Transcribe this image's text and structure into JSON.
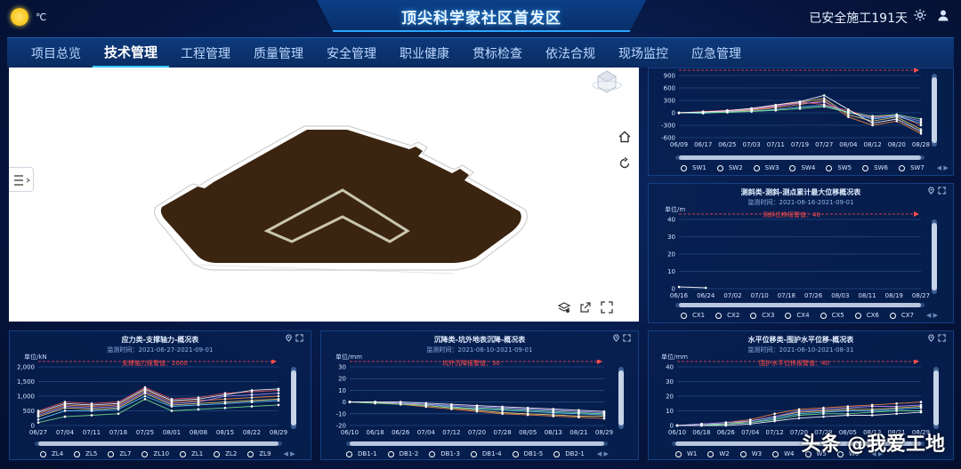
{
  "header": {
    "weather_icon": "sun-icon",
    "temperature_unit": "℃",
    "title": "顶尖科学家社区首发区",
    "safe_days": "已安全施工191天",
    "settings_icon": "gear-icon",
    "user_icon": "user-icon"
  },
  "nav": {
    "items": [
      "项目总览",
      "技术管理",
      "工程管理",
      "质量管理",
      "安全管理",
      "职业健康",
      "贯标检查",
      "依法合规",
      "现场监控",
      "应急管理"
    ],
    "active_index": 1
  },
  "viewport": {
    "tools": [
      "home-icon",
      "refresh-icon",
      "layers-icon",
      "export-icon",
      "fullscreen-icon"
    ]
  },
  "colors": {
    "accent": "#35c3ff",
    "panel_bg": "#072050",
    "warning": "#ff4b4b",
    "pit_fill": "#3b2410"
  },
  "panels": {
    "sw": {
      "title": "",
      "subtitle": "",
      "unit": "",
      "warning": "",
      "legend": [
        "SW1",
        "SW2",
        "SW3",
        "SW4",
        "SW5",
        "SW6",
        "SW7"
      ]
    },
    "cx": {
      "title": "测斜类-测斜-测点累计最大位移概况表",
      "subtitle": "监测时间：2021-06-16-2021-09-01",
      "unit": "单位/m",
      "warning": "测斜位移报警值：40",
      "legend": [
        "CX1",
        "CX2",
        "CX3",
        "CX4",
        "CX5",
        "CX6",
        "CX7"
      ]
    },
    "zl": {
      "title": "应力类-支撑轴力-概况表",
      "subtitle": "监测时间：2021-06-27-2021-09-01",
      "unit": "单位/kN",
      "warning": "支撑轴力报警值：2000",
      "legend": [
        "ZL4",
        "ZL5",
        "ZL7",
        "ZL10",
        "ZL1",
        "ZL2",
        "ZL9"
      ]
    },
    "db": {
      "title": "沉降类-坑外地表沉降-概况表",
      "subtitle": "监测时间：2021-06-10-2021-09-01",
      "unit": "单位/mm",
      "warning": "坑外沉降报警值：30",
      "legend": [
        "DB1-1",
        "DB1-2",
        "DB1-3",
        "DB1-4",
        "DB1-5",
        "DB2-1"
      ]
    },
    "w": {
      "title": "水平位移类-围护水平位移-概况表",
      "subtitle": "监测时间：2021-06-10-2021-08-31",
      "unit": "单位/mm",
      "warning": "围护水平位移报警值：40",
      "legend": [
        "W1",
        "W2",
        "W3",
        "W4",
        "W5",
        "W6"
      ]
    }
  },
  "chart_data": [
    {
      "id": "sw",
      "type": "line",
      "title": "",
      "x": [
        "06/09",
        "06/17",
        "06/25",
        "07/03",
        "07/11",
        "07/19",
        "07/27",
        "08/04",
        "08/12",
        "08/20",
        "08/28"
      ],
      "yticks": [
        900,
        600,
        300,
        0,
        -300,
        -600
      ],
      "ylim": [
        -600,
        900
      ],
      "warning_value": 900,
      "series": [
        {
          "name": "SW1",
          "color": "#ff8a3d",
          "values": [
            0,
            20,
            30,
            60,
            120,
            200,
            300,
            -100,
            -300,
            -200,
            -500
          ]
        },
        {
          "name": "SW2",
          "color": "#ffd166",
          "values": [
            0,
            10,
            20,
            80,
            150,
            250,
            350,
            -50,
            -200,
            -100,
            -400
          ]
        },
        {
          "name": "SW3",
          "color": "#ff5a5a",
          "values": [
            0,
            30,
            60,
            100,
            180,
            260,
            200,
            50,
            -100,
            -50,
            -300
          ]
        },
        {
          "name": "SW4",
          "color": "#6ad3ff",
          "values": [
            0,
            -10,
            20,
            40,
            80,
            140,
            180,
            20,
            -150,
            -80,
            -250
          ]
        },
        {
          "name": "SW5",
          "color": "#b48cff",
          "values": [
            0,
            15,
            40,
            90,
            160,
            230,
            260,
            0,
            -120,
            -60,
            -200
          ]
        },
        {
          "name": "SW6",
          "color": "#7be38a",
          "values": [
            0,
            5,
            10,
            30,
            60,
            100,
            150,
            10,
            -80,
            -40,
            -150
          ]
        },
        {
          "name": "SW7",
          "color": "#ffffff",
          "values": [
            0,
            20,
            50,
            110,
            190,
            270,
            420,
            80,
            -250,
            -150,
            -450
          ]
        }
      ]
    },
    {
      "id": "cx",
      "type": "line",
      "title": "测斜类-测斜-测点累计最大位移概况表",
      "x": [
        "06/16",
        "06/24",
        "07/02",
        "07/10",
        "07/18",
        "07/26",
        "08/03",
        "08/11",
        "08/19",
        "08/27"
      ],
      "yticks": [
        40,
        30,
        20,
        10,
        0
      ],
      "ylim": [
        0,
        40
      ],
      "warning_value": 40,
      "series": [
        {
          "name": "CX1",
          "color": "#ffffff",
          "values": [
            1,
            0.5,
            null,
            null,
            null,
            null,
            null,
            null,
            null,
            null
          ]
        }
      ]
    },
    {
      "id": "zl",
      "type": "line",
      "title": "应力类-支撑轴力-概况表",
      "x": [
        "06/27",
        "07/04",
        "07/11",
        "07/18",
        "07/25",
        "08/01",
        "08/08",
        "08/15",
        "08/22",
        "08/29"
      ],
      "yticks": [
        2000,
        1500,
        1000,
        500,
        0
      ],
      "ylim": [
        0,
        2000
      ],
      "warning_value": 2000,
      "series": [
        {
          "name": "ZL4",
          "color": "#ff8a3d",
          "values": [
            400,
            700,
            650,
            700,
            1200,
            800,
            850,
            900,
            950,
            1000
          ]
        },
        {
          "name": "ZL5",
          "color": "#ffd166",
          "values": [
            300,
            600,
            550,
            600,
            1100,
            700,
            750,
            800,
            850,
            900
          ]
        },
        {
          "name": "ZL7",
          "color": "#6ad3ff",
          "values": [
            200,
            500,
            500,
            550,
            1000,
            650,
            700,
            750,
            800,
            850
          ]
        },
        {
          "name": "ZL10",
          "color": "#ff5a5a",
          "values": [
            500,
            800,
            750,
            800,
            1300,
            900,
            950,
            1100,
            1150,
            1200
          ]
        },
        {
          "name": "ZL1",
          "color": "#7be38a",
          "values": [
            100,
            300,
            350,
            400,
            900,
            500,
            550,
            600,
            650,
            700
          ]
        },
        {
          "name": "ZL2",
          "color": "#b48cff",
          "values": [
            350,
            650,
            600,
            650,
            1150,
            750,
            800,
            1000,
            1050,
            1100
          ]
        },
        {
          "name": "ZL9",
          "color": "#ffffff",
          "values": [
            450,
            750,
            700,
            750,
            1250,
            850,
            900,
            1050,
            1200,
            1250
          ]
        }
      ]
    },
    {
      "id": "db",
      "type": "line",
      "title": "沉降类-坑外地表沉降-概况表",
      "x": [
        "06/10",
        "06/18",
        "06/26",
        "07/04",
        "07/12",
        "07/20",
        "07/28",
        "08/05",
        "08/13",
        "08/21",
        "08/29"
      ],
      "yticks": [
        30,
        20,
        10,
        0,
        -10,
        -20
      ],
      "ylim": [
        -20,
        30
      ],
      "warning_value": 30,
      "series": [
        {
          "name": "DB1-1",
          "color": "#ff8a3d",
          "values": [
            0,
            0,
            -2,
            -4,
            -6,
            -8,
            -10,
            -11,
            -12,
            -13,
            -14
          ]
        },
        {
          "name": "DB1-2",
          "color": "#ffd166",
          "values": [
            0,
            -1,
            -1,
            -3,
            -5,
            -7,
            -9,
            -10,
            -11,
            -12,
            -12
          ]
        },
        {
          "name": "DB1-3",
          "color": "#6ad3ff",
          "values": [
            0,
            0,
            -1,
            -2,
            -4,
            -6,
            -7,
            -8,
            -9,
            -10,
            -11
          ]
        },
        {
          "name": "DB1-4",
          "color": "#7be38a",
          "values": [
            0,
            -1,
            -2,
            -3,
            -5,
            -5,
            -6,
            -7,
            -8,
            -9,
            -10
          ]
        },
        {
          "name": "DB1-5",
          "color": "#b48cff",
          "values": [
            0,
            0,
            -1,
            -2,
            -3,
            -4,
            -5,
            -6,
            -7,
            -8,
            -9
          ]
        },
        {
          "name": "DB2-1",
          "color": "#ffffff",
          "values": [
            0,
            0,
            0,
            -1,
            -2,
            -3,
            -4,
            -5,
            -6,
            -7,
            -8
          ]
        }
      ]
    },
    {
      "id": "w",
      "type": "line",
      "title": "水平位移类-围护水平位移-概况表",
      "x": [
        "06/10",
        "06/18",
        "06/26",
        "07/04",
        "07/12",
        "07/20",
        "07/28",
        "08/05",
        "08/13",
        "08/21",
        "08/29"
      ],
      "yticks": [
        40,
        30,
        20,
        10,
        0
      ],
      "ylim": [
        0,
        40
      ],
      "warning_value": 40,
      "series": [
        {
          "name": "W1",
          "color": "#ff8a3d",
          "values": [
            0,
            1,
            2,
            4,
            8,
            11,
            12,
            13,
            14,
            15,
            16
          ]
        },
        {
          "name": "W2",
          "color": "#ffd166",
          "values": [
            0,
            0,
            1,
            3,
            6,
            9,
            10,
            11,
            11,
            12,
            13
          ]
        },
        {
          "name": "W3",
          "color": "#6ad3ff",
          "values": [
            0,
            1,
            1,
            2,
            5,
            8,
            9,
            10,
            10,
            11,
            12
          ]
        },
        {
          "name": "W4",
          "color": "#7be38a",
          "values": [
            0,
            0,
            1,
            2,
            4,
            7,
            8,
            8,
            9,
            10,
            10
          ]
        },
        {
          "name": "W5",
          "color": "#b48cff",
          "values": [
            0,
            1,
            2,
            3,
            6,
            10,
            11,
            12,
            13,
            13,
            14
          ]
        },
        {
          "name": "W6",
          "color": "#ffffff",
          "values": [
            0,
            0,
            0,
            1,
            3,
            5,
            6,
            7,
            7,
            8,
            9
          ]
        }
      ]
    }
  ],
  "watermark": "头条 @我爱工地"
}
